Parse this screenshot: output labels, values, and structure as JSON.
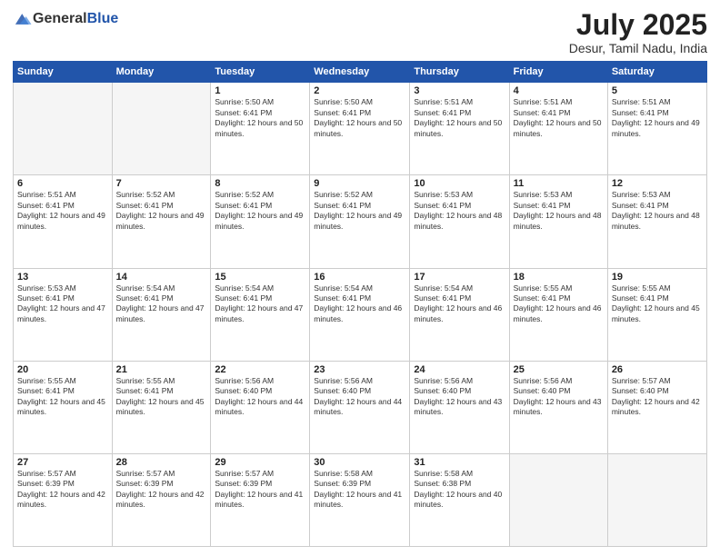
{
  "header": {
    "logo_general": "General",
    "logo_blue": "Blue",
    "month_title": "July 2025",
    "subtitle": "Desur, Tamil Nadu, India"
  },
  "weekdays": [
    "Sunday",
    "Monday",
    "Tuesday",
    "Wednesday",
    "Thursday",
    "Friday",
    "Saturday"
  ],
  "weeks": [
    [
      {
        "day": "",
        "info": ""
      },
      {
        "day": "",
        "info": ""
      },
      {
        "day": "1",
        "info": "Sunrise: 5:50 AM\nSunset: 6:41 PM\nDaylight: 12 hours and 50 minutes."
      },
      {
        "day": "2",
        "info": "Sunrise: 5:50 AM\nSunset: 6:41 PM\nDaylight: 12 hours and 50 minutes."
      },
      {
        "day": "3",
        "info": "Sunrise: 5:51 AM\nSunset: 6:41 PM\nDaylight: 12 hours and 50 minutes."
      },
      {
        "day": "4",
        "info": "Sunrise: 5:51 AM\nSunset: 6:41 PM\nDaylight: 12 hours and 50 minutes."
      },
      {
        "day": "5",
        "info": "Sunrise: 5:51 AM\nSunset: 6:41 PM\nDaylight: 12 hours and 49 minutes."
      }
    ],
    [
      {
        "day": "6",
        "info": "Sunrise: 5:51 AM\nSunset: 6:41 PM\nDaylight: 12 hours and 49 minutes."
      },
      {
        "day": "7",
        "info": "Sunrise: 5:52 AM\nSunset: 6:41 PM\nDaylight: 12 hours and 49 minutes."
      },
      {
        "day": "8",
        "info": "Sunrise: 5:52 AM\nSunset: 6:41 PM\nDaylight: 12 hours and 49 minutes."
      },
      {
        "day": "9",
        "info": "Sunrise: 5:52 AM\nSunset: 6:41 PM\nDaylight: 12 hours and 49 minutes."
      },
      {
        "day": "10",
        "info": "Sunrise: 5:53 AM\nSunset: 6:41 PM\nDaylight: 12 hours and 48 minutes."
      },
      {
        "day": "11",
        "info": "Sunrise: 5:53 AM\nSunset: 6:41 PM\nDaylight: 12 hours and 48 minutes."
      },
      {
        "day": "12",
        "info": "Sunrise: 5:53 AM\nSunset: 6:41 PM\nDaylight: 12 hours and 48 minutes."
      }
    ],
    [
      {
        "day": "13",
        "info": "Sunrise: 5:53 AM\nSunset: 6:41 PM\nDaylight: 12 hours and 47 minutes."
      },
      {
        "day": "14",
        "info": "Sunrise: 5:54 AM\nSunset: 6:41 PM\nDaylight: 12 hours and 47 minutes."
      },
      {
        "day": "15",
        "info": "Sunrise: 5:54 AM\nSunset: 6:41 PM\nDaylight: 12 hours and 47 minutes."
      },
      {
        "day": "16",
        "info": "Sunrise: 5:54 AM\nSunset: 6:41 PM\nDaylight: 12 hours and 46 minutes."
      },
      {
        "day": "17",
        "info": "Sunrise: 5:54 AM\nSunset: 6:41 PM\nDaylight: 12 hours and 46 minutes."
      },
      {
        "day": "18",
        "info": "Sunrise: 5:55 AM\nSunset: 6:41 PM\nDaylight: 12 hours and 46 minutes."
      },
      {
        "day": "19",
        "info": "Sunrise: 5:55 AM\nSunset: 6:41 PM\nDaylight: 12 hours and 45 minutes."
      }
    ],
    [
      {
        "day": "20",
        "info": "Sunrise: 5:55 AM\nSunset: 6:41 PM\nDaylight: 12 hours and 45 minutes."
      },
      {
        "day": "21",
        "info": "Sunrise: 5:55 AM\nSunset: 6:41 PM\nDaylight: 12 hours and 45 minutes."
      },
      {
        "day": "22",
        "info": "Sunrise: 5:56 AM\nSunset: 6:40 PM\nDaylight: 12 hours and 44 minutes."
      },
      {
        "day": "23",
        "info": "Sunrise: 5:56 AM\nSunset: 6:40 PM\nDaylight: 12 hours and 44 minutes."
      },
      {
        "day": "24",
        "info": "Sunrise: 5:56 AM\nSunset: 6:40 PM\nDaylight: 12 hours and 43 minutes."
      },
      {
        "day": "25",
        "info": "Sunrise: 5:56 AM\nSunset: 6:40 PM\nDaylight: 12 hours and 43 minutes."
      },
      {
        "day": "26",
        "info": "Sunrise: 5:57 AM\nSunset: 6:40 PM\nDaylight: 12 hours and 42 minutes."
      }
    ],
    [
      {
        "day": "27",
        "info": "Sunrise: 5:57 AM\nSunset: 6:39 PM\nDaylight: 12 hours and 42 minutes."
      },
      {
        "day": "28",
        "info": "Sunrise: 5:57 AM\nSunset: 6:39 PM\nDaylight: 12 hours and 42 minutes."
      },
      {
        "day": "29",
        "info": "Sunrise: 5:57 AM\nSunset: 6:39 PM\nDaylight: 12 hours and 41 minutes."
      },
      {
        "day": "30",
        "info": "Sunrise: 5:58 AM\nSunset: 6:39 PM\nDaylight: 12 hours and 41 minutes."
      },
      {
        "day": "31",
        "info": "Sunrise: 5:58 AM\nSunset: 6:38 PM\nDaylight: 12 hours and 40 minutes."
      },
      {
        "day": "",
        "info": ""
      },
      {
        "day": "",
        "info": ""
      }
    ]
  ]
}
